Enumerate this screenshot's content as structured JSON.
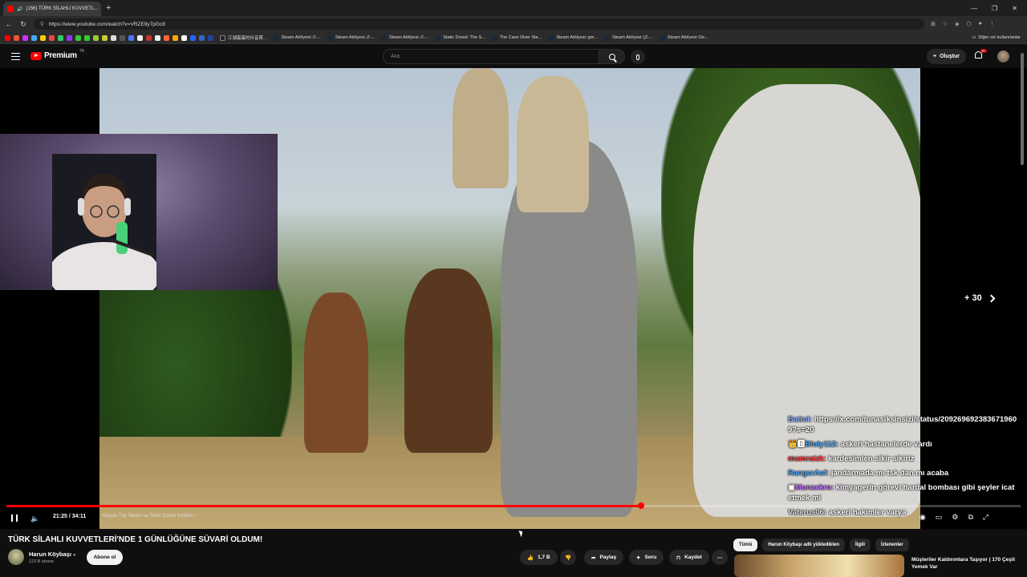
{
  "browser": {
    "tab_title": "(156) TÜRK SİLAHLI KUVVETL...",
    "url": "https://www.youtube.com/watch?v=VRZE9y7pGc8",
    "bookmarks": [
      "江湖蛋蛋的抖音首...",
      "Steam Atölyesi::Z-...",
      "Steam Atölyesi::Z-...",
      "Steam Atölyesi::Z-...",
      "Static Dread: The S...",
      "The Cave Diver Ste...",
      "Steam Atölyesi::gm...",
      "Steam Atölyesi::[Z-...",
      "Steam Atölyesi::De..."
    ],
    "other_bookmarks": "Diğer sık kullanılanlar"
  },
  "yt": {
    "logo_text": "Premium",
    "logo_region": "TR",
    "search_placeholder": "Ara",
    "create_label": "Oluştur",
    "notification_count": "9+"
  },
  "player": {
    "skip_label": "+ 30",
    "current_time": "21:25 / 34:11",
    "chapter": "Koşulu Top Takımı ve Tarihi Süvari Kültürü",
    "progress": 0.626
  },
  "chat": [
    {
      "user": "Battol:",
      "color": "#8fb0ff",
      "text": "https://x.com/tunasiksinsizi/status/2092696923836719609?s=20"
    },
    {
      "user": "Bluly112:",
      "color": "#4aa8ff",
      "text": "askeri hastanelerde vardı"
    },
    {
      "user": "mumraizk:",
      "color": "#ff4040",
      "text": "kardesimlen sikir sikiriz"
    },
    {
      "user": "RangerAsf:",
      "color": "#4aa8ff",
      "text": "jandarmada mı tsk dan mı acaba"
    },
    {
      "user": "Munaxkro:",
      "color": "#c070ff",
      "text": "kimyagerin görevi hardal bombası gibi şeyler icat etmek mi"
    },
    {
      "user": "Vaterus06:",
      "color": "#dddddd",
      "text": "askeri hakimler varya"
    }
  ],
  "video": {
    "title": "TÜRK SİLAHLI KUVVETLERİ'NDE 1 GÜNLÜĞÜNE SÜVARİ OLDUM!",
    "channel": "Harun Köybaşı",
    "subscribers": "123 B abone",
    "subscribe_label": "Abone ol",
    "likes": "1,7 B",
    "share_label": "Paylaş",
    "ask_label": "Soru",
    "save_label": "Kaydet"
  },
  "recommendations": {
    "tabs": [
      "Tümü",
      "Harun Köybaşı adlı yüklediklen",
      "İlgili",
      "İzlenenler"
    ],
    "first_title": "Müşteriler Kaldırımlara Taşıyor | 170 Çeşit Yemek Var"
  }
}
